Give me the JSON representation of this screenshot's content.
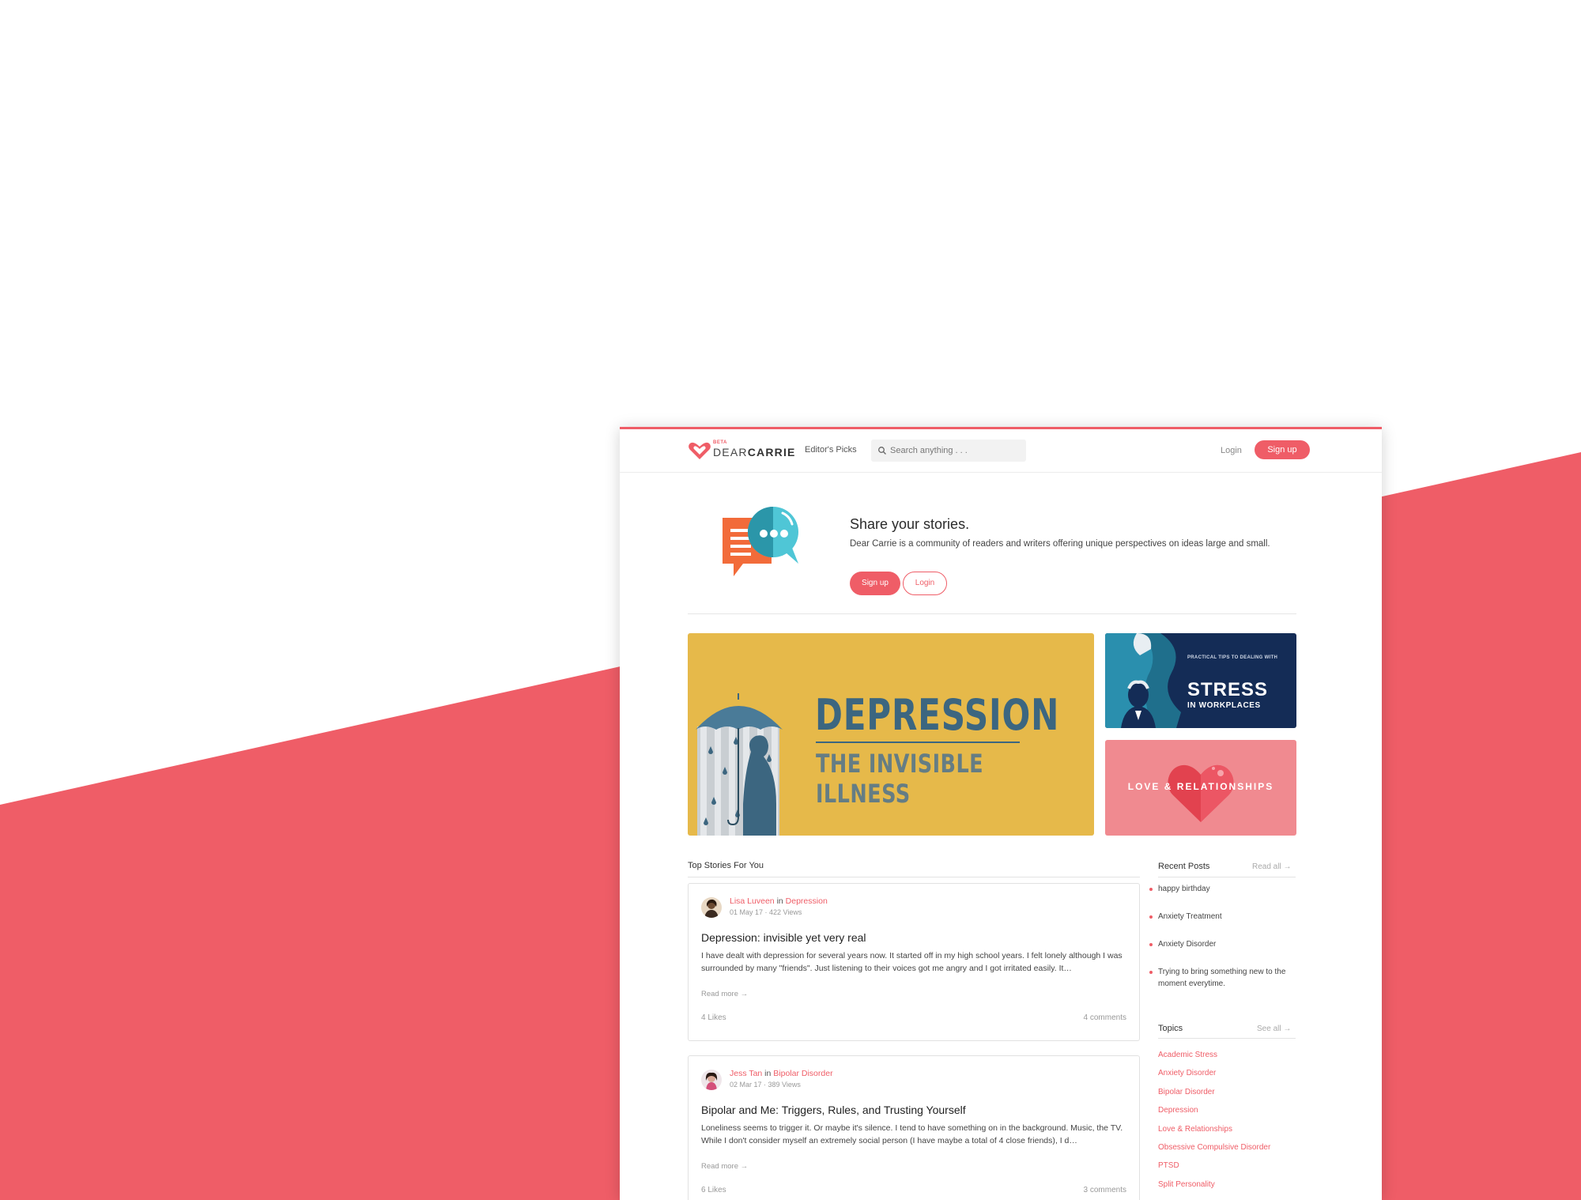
{
  "colors": {
    "accent": "#ef5d67",
    "navy": "#142c56",
    "mustard": "#e6b94a"
  },
  "brand": {
    "beta": "BETA",
    "name_light": "DEAR",
    "name_bold": "CARRIE",
    "icon": "heart-logo-icon"
  },
  "nav": {
    "editors_picks": "Editor's Picks",
    "search_placeholder": "Search anything . . .",
    "login": "Login",
    "signup": "Sign up"
  },
  "hero": {
    "title": "Share your stories.",
    "description": "Dear Carrie is a community of readers and writers offering unique perspectives on ideas large and small.",
    "signup": "Sign up",
    "login": "Login",
    "icon": "chat-bubbles-icon"
  },
  "banners": {
    "depression": {
      "title": "DEPRESSION",
      "subtitle": "THE INVISIBLE ILLNESS"
    },
    "stress": {
      "kicker": "PRACTICAL TIPS TO DEALING WITH",
      "title": "STRESS",
      "subtitle": "IN WORKPLACES"
    },
    "love": {
      "title": "LOVE & RELATIONSHIPS"
    }
  },
  "top_stories": {
    "heading": "Top Stories For You",
    "stories": [
      {
        "author": "Lisa Luveen",
        "in": "in",
        "topic": "Depression",
        "meta": "01 May 17 · 422 Views",
        "title": "Depression: invisible yet very real",
        "body": "I have dealt with depression for several years now. It started off in my high school years. I felt lonely although I was surrounded by many \"friends\". Just listening to their voices got me angry and I got irritated easily. It…",
        "read_more": "Read more →",
        "likes": "4 Likes",
        "comments": "4 comments"
      },
      {
        "author": "Jess Tan",
        "in": "in",
        "topic": "Bipolar Disorder",
        "meta": "02 Mar 17 · 389 Views",
        "title": "Bipolar and Me: Triggers, Rules, and Trusting Yourself",
        "body": "Loneliness seems to trigger it. Or maybe it's silence. I tend to have something on in the background. Music, the TV. While I don't consider myself an extremely social person (I have maybe a total of 4 close friends), I d…",
        "read_more": "Read more →",
        "likes": "6 Likes",
        "comments": "3 comments"
      }
    ]
  },
  "recent_posts": {
    "heading": "Recent Posts",
    "link": "Read all →",
    "items": [
      "happy birthday",
      "Anxiety Treatment",
      "Anxiety Disorder",
      "Trying to bring something new to the moment everytime."
    ]
  },
  "topics": {
    "heading": "Topics",
    "link": "See all →",
    "items": [
      "Academic Stress",
      "Anxiety Disorder",
      "Bipolar Disorder",
      "Depression",
      "Love & Relationships",
      "Obsessive Compulsive Disorder",
      "PTSD",
      "Split Personality"
    ]
  }
}
